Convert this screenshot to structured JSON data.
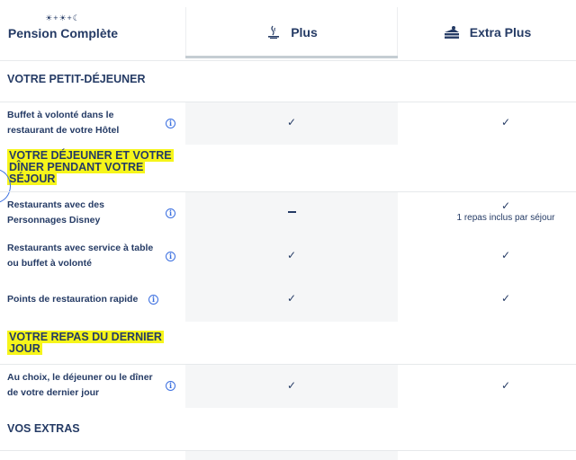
{
  "header": {
    "pension_icons": "☀+☀+☾",
    "pension_title": "Pension Complète",
    "tabs": [
      {
        "label": "Plus",
        "icon": "coffee-cup-icon",
        "active": true
      },
      {
        "label": "Extra Plus",
        "icon": "cake-slice-icon",
        "active": false
      }
    ]
  },
  "sections": [
    {
      "title": "VOTRE PETIT-DÉJEUNER",
      "highlighted": false,
      "rows": [
        {
          "label": "Buffet à volonté dans le restaurant de votre Hôtel",
          "info": true,
          "plus": "check",
          "extra": "check",
          "extra_note": ""
        }
      ]
    },
    {
      "title": "VOTRE DÉJEUNER ET VOTRE DÎNER PENDANT VOTRE SÉJOUR",
      "highlighted": true,
      "rows": [
        {
          "label": "Restaurants avec des Personnages Disney",
          "info": true,
          "plus": "dash",
          "extra": "check",
          "extra_note": "1 repas inclus par séjour"
        },
        {
          "label": "Restaurants avec service à table ou buffet à volonté",
          "info": true,
          "plus": "check",
          "extra": "check",
          "extra_note": ""
        },
        {
          "label": "Points de restauration rapide",
          "info": true,
          "plus": "check",
          "extra": "check",
          "extra_note": ""
        }
      ]
    },
    {
      "title": "VOTRE REPAS DU DERNIER JOUR",
      "highlighted": true,
      "rows": [
        {
          "label": "Au choix, le déjeuner ou le dîner de votre dernier jour",
          "info": true,
          "plus": "check",
          "extra": "check",
          "extra_note": ""
        }
      ]
    },
    {
      "title": "VOS EXTRAS",
      "highlighted": false,
      "rows": []
    }
  ],
  "symbols": {
    "check": "✓",
    "info": "i"
  },
  "colors": {
    "text": "#253b65",
    "info": "#3b6fe0",
    "highlight": "#f6f51a",
    "plus_column_bg": "#f5f6f7"
  }
}
